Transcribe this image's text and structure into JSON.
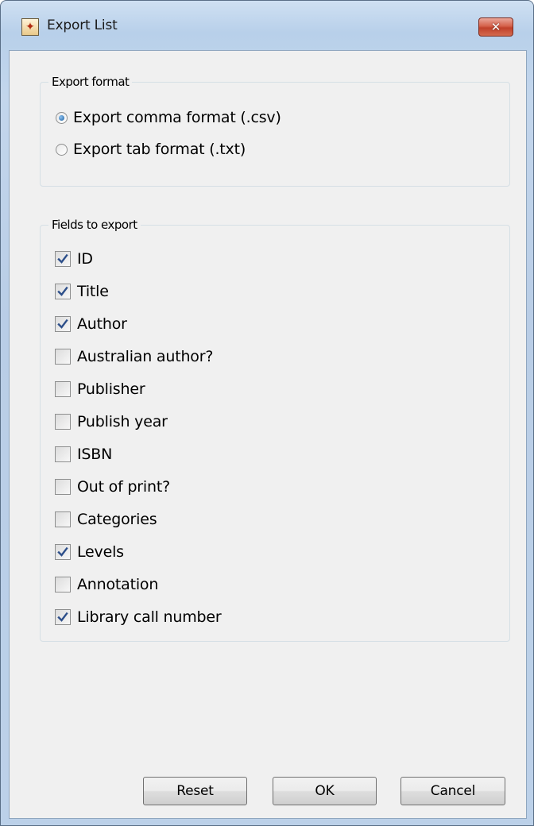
{
  "window": {
    "title": "Export List",
    "app_icon": "app-icon",
    "close_glyph": "✕"
  },
  "export_format": {
    "legend": "Export format",
    "options": [
      {
        "label": "Export comma format (.csv)",
        "selected": true
      },
      {
        "label": "Export tab format (.txt)",
        "selected": false
      }
    ]
  },
  "fields": {
    "legend": "Fields to export",
    "items": [
      {
        "label": "ID",
        "checked": true
      },
      {
        "label": "Title",
        "checked": true
      },
      {
        "label": "Author",
        "checked": true
      },
      {
        "label": "Australian author?",
        "checked": false
      },
      {
        "label": "Publisher",
        "checked": false
      },
      {
        "label": "Publish year",
        "checked": false
      },
      {
        "label": "ISBN",
        "checked": false
      },
      {
        "label": "Out of print?",
        "checked": false
      },
      {
        "label": "Categories",
        "checked": false
      },
      {
        "label": "Levels",
        "checked": true
      },
      {
        "label": "Annotation",
        "checked": false
      },
      {
        "label": "Library call number",
        "checked": true
      }
    ]
  },
  "buttons": {
    "reset": "Reset",
    "ok": "OK",
    "cancel": "Cancel"
  }
}
